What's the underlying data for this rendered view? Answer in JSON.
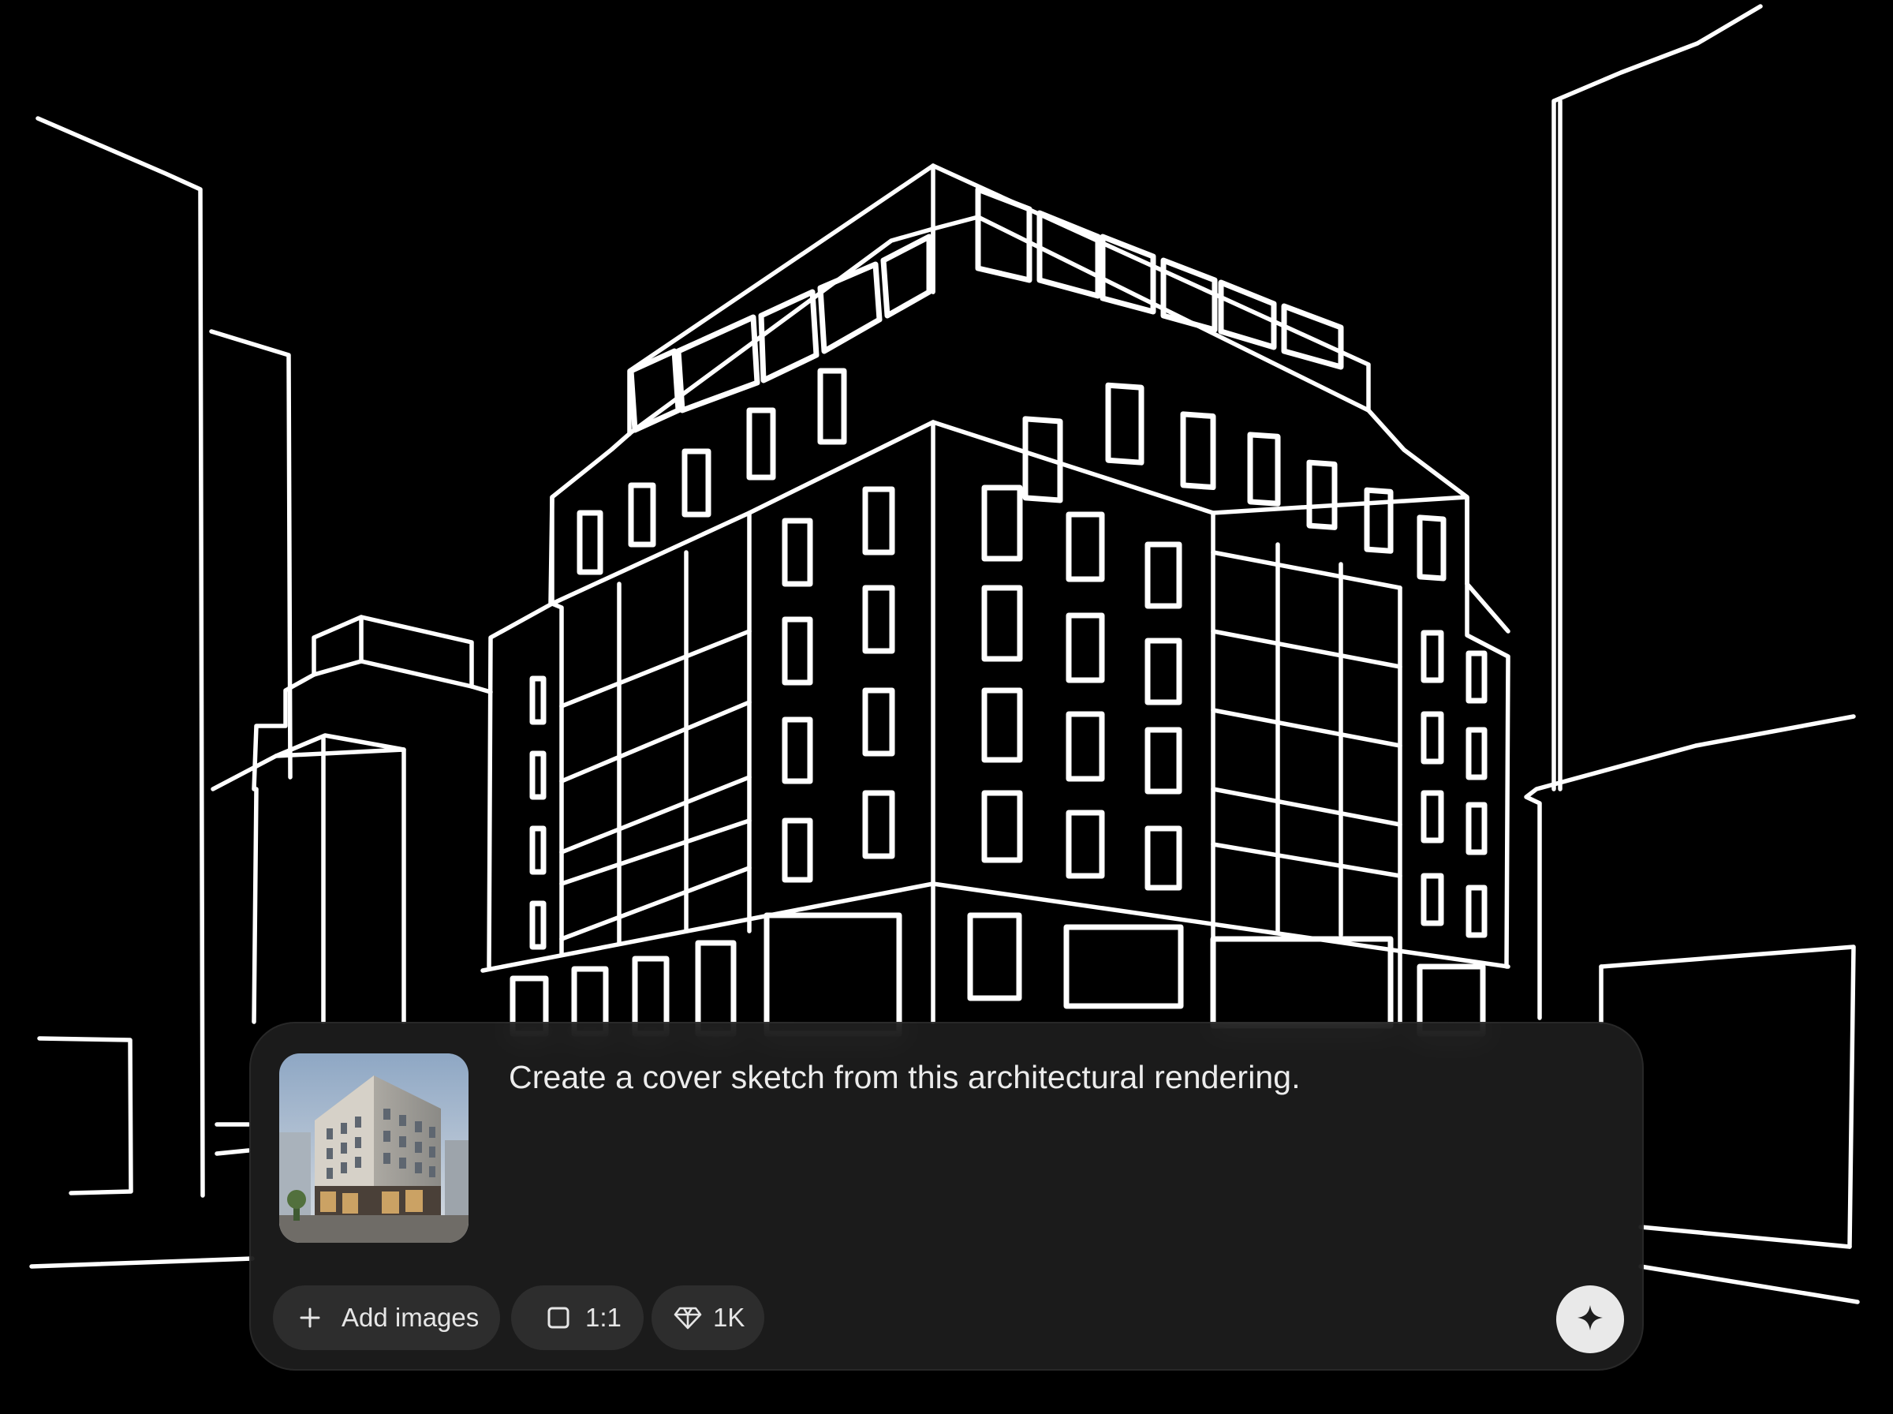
{
  "composer": {
    "prompt_text": "Create a cover sketch from this architectural rendering.",
    "attachment_thumbnail": "architectural rendering of a multi-story building",
    "buttons": {
      "add_images_label": "Add images",
      "aspect_ratio_label": "1:1",
      "resolution_label": "1K"
    },
    "icons": {
      "add": "plus-icon",
      "aspect_ratio": "square-icon",
      "resolution": "diamond-icon",
      "send": "sparkle-icon"
    }
  },
  "canvas": {
    "description_icon": "sketch-canvas",
    "colors": {
      "background": "#000000",
      "lines": "#ffffff"
    }
  },
  "colors": {
    "panel": "#1e1e1e",
    "chip": "#2d2d2d",
    "text": "#ececec",
    "send_button": "#e9e9e9"
  }
}
